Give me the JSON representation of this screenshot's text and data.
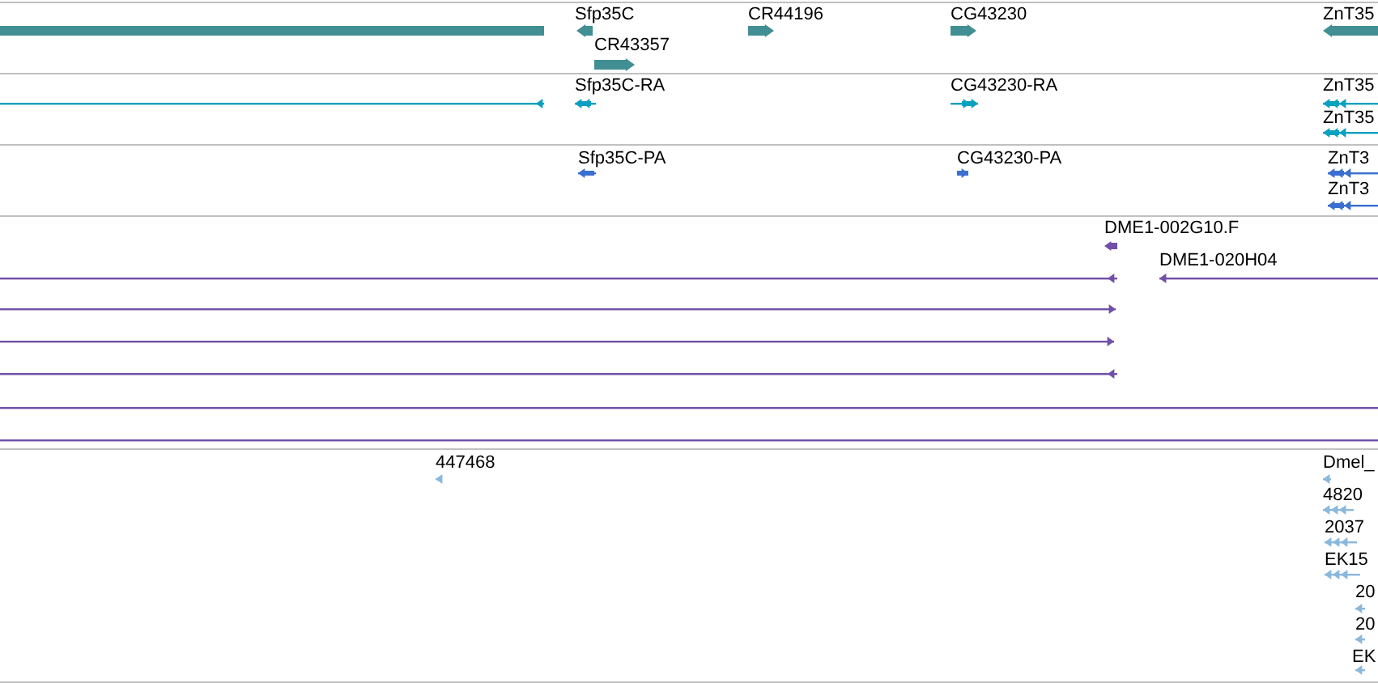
{
  "tracks": [
    {
      "kind": "gene",
      "color": "#428f93",
      "features": [
        {
          "kind": "bar"
        },
        {
          "kind": "bar",
          "label": "Sfp35C",
          "reverse": true
        },
        {
          "kind": "bar",
          "label": "CR43357",
          "reverse": false
        },
        {
          "kind": "bar",
          "label": "CR44196",
          "reverse": false
        },
        {
          "kind": "bar",
          "label": "CG43230",
          "reverse": false
        },
        {
          "kind": "bar",
          "label": "ZnT35",
          "reverse": true
        }
      ]
    },
    {
      "kind": "transcript",
      "color": "#0aa0c0",
      "features": [
        {
          "kind": "line",
          "reverse": true
        },
        {
          "kind": "exons",
          "label": "Sfp35C-RA",
          "reverse": true
        },
        {
          "kind": "exons",
          "label": "CG43230-RA",
          "reverse": false
        },
        {
          "kind": "exons",
          "label": "ZnT35",
          "reverse": true
        },
        {
          "kind": "exons",
          "label": "ZnT35",
          "reverse": true
        }
      ]
    },
    {
      "kind": "protein",
      "color": "#3a6fd0",
      "features": [
        {
          "kind": "exons",
          "label": "Sfp35C-PA",
          "reverse": true
        },
        {
          "kind": "exons",
          "label": "CG43230-PA",
          "reverse": false
        },
        {
          "kind": "exons",
          "label": "ZnT3",
          "reverse": true
        },
        {
          "kind": "exons",
          "label": "ZnT3",
          "reverse": true
        }
      ]
    },
    {
      "kind": "alignment",
      "color": "#7050a8",
      "features": [
        {
          "kind": "bar",
          "label": "DME1-002G10.F",
          "reverse": true
        },
        {
          "kind": "line",
          "reverse": true
        },
        {
          "kind": "line",
          "label": "DME1-020H04",
          "reverse": true
        },
        {
          "kind": "line",
          "reverse": false
        },
        {
          "kind": "line",
          "reverse": false
        },
        {
          "kind": "line",
          "reverse": true
        },
        {
          "kind": "line"
        },
        {
          "kind": "line"
        }
      ]
    },
    {
      "kind": "est",
      "color": "#8ab8dc",
      "features": [
        {
          "kind": "exons",
          "label": "447468",
          "reverse": true
        },
        {
          "kind": "exons",
          "label": "Dmel_",
          "reverse": true
        },
        {
          "kind": "exons",
          "label": "4820",
          "reverse": true
        },
        {
          "kind": "exons",
          "label": "2037",
          "reverse": true
        },
        {
          "kind": "exons",
          "label": "EK15",
          "reverse": true
        },
        {
          "kind": "exons",
          "label": "20",
          "reverse": true
        },
        {
          "kind": "exons",
          "label": "20",
          "reverse": true
        },
        {
          "kind": "exons",
          "label": "EK",
          "reverse": true
        }
      ]
    }
  ]
}
